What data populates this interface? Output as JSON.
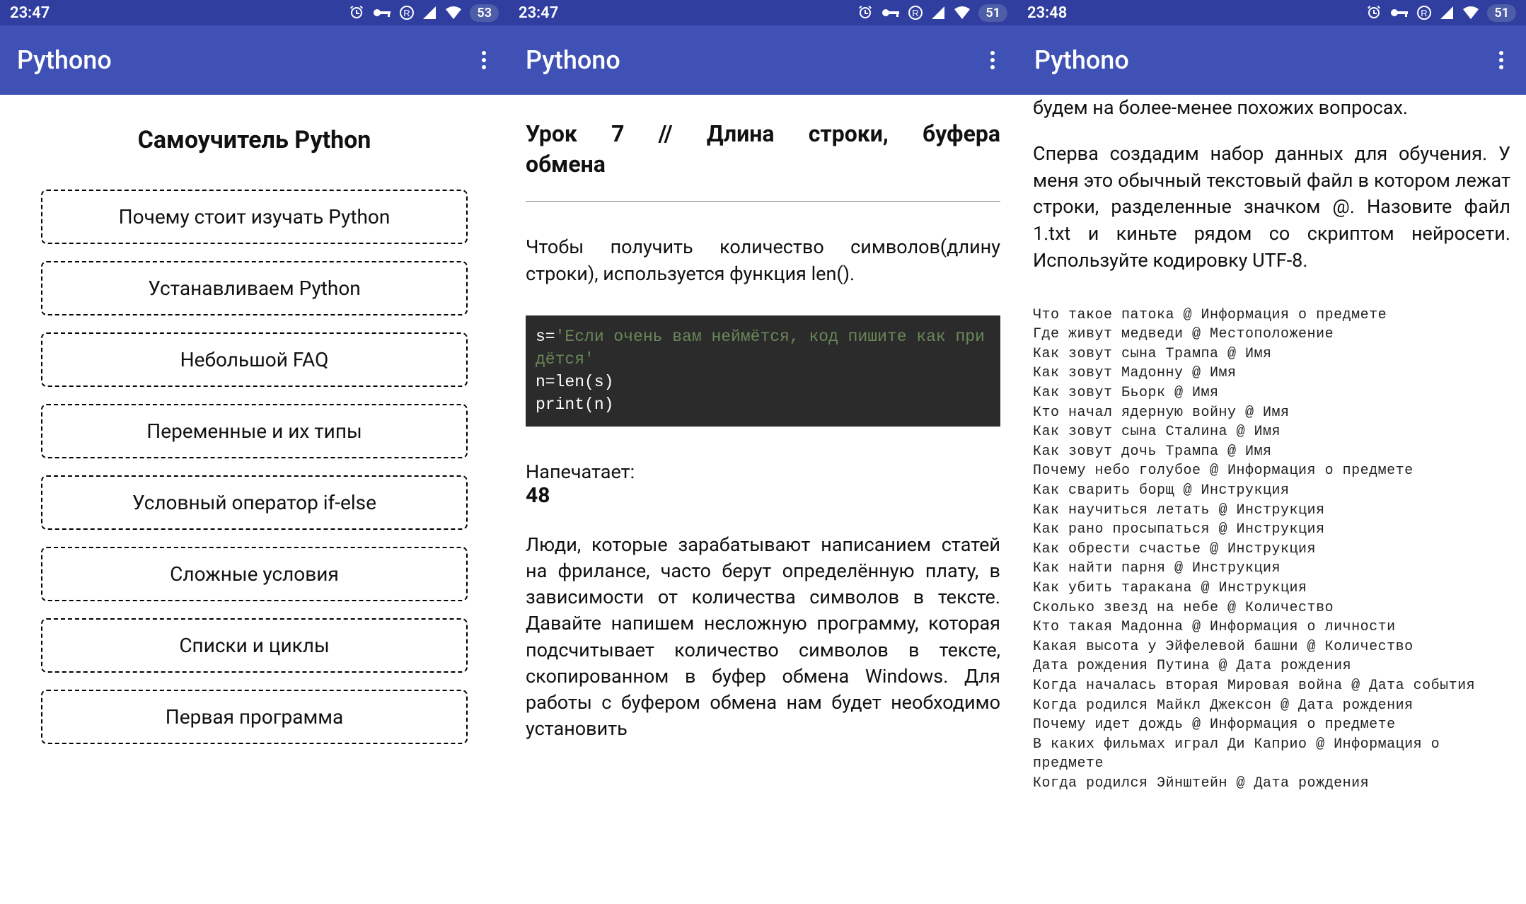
{
  "screen1": {
    "status": {
      "time": "23:47",
      "battery": "53"
    },
    "app_title": "Pythono",
    "page_title": "Самоучитель Python",
    "lessons": [
      "Почему стоит изучать Python",
      "Устанавливаем Python",
      "Небольшой FAQ",
      "Переменные и их типы",
      "Условный оператор if-else",
      "Сложные условия",
      "Списки и циклы",
      "Первая программа"
    ]
  },
  "screen2": {
    "status": {
      "time": "23:47",
      "battery": "51"
    },
    "app_title": "Pythono",
    "lesson_title_l1": "Урок 7 // Длина строки, буфера",
    "lesson_title_l2": "обмена",
    "para1": "Чтобы получить количество символов(длину строки), используется функция len().",
    "code": {
      "line1a": "s=",
      "line1b": "'Если очень вам неймётся, код пишите как придётся'",
      "line2": "n=len(s)",
      "line3": "print(n)"
    },
    "print_label": "Напечатает:",
    "print_value": "48",
    "para2": "Люди, которые зарабатывают написанием статей на фрилансе, часто берут определённую плату, в зависимости от количества символов в тексте. Давайте напишем несложную программу, которая подсчитывает количество символов в тексте, скопированном в буфер обмена Windows. Для работы с буфером обмена нам будет необходимо установить"
  },
  "screen3": {
    "status": {
      "time": "23:48",
      "battery": "51"
    },
    "app_title": "Pythono",
    "top_line": "будем на более-менее похожих вопросах.",
    "para": "Сперва создадим набор данных для обучения. У меня это обычный текстовый файл в котором лежат строки, разделенные значком @. Назовите файл 1.txt и киньте рядом со скриптом нейросети. Используйте кодировку UTF-8.",
    "dataset": "Что такое патока @ Информация о предмете\nГде живут медведи @ Местоположение\nКак зовут сына Трампа @ Имя\nКак зовут Мадонну @ Имя\nКак зовут Бьорк @ Имя\nКто начал ядерную войну @ Имя\nКак зовут сына Сталина @ Имя\nКак зовут дочь Трампа @ Имя\nПочему небо голубое @ Информация о предмете\nКак сварить борщ @ Инструкция\nКак научиться летать @ Инструкция\nКак рано просыпаться @ Инструкция\nКак обрести счастье @ Инструкция\nКак найти парня @ Инструкция\nКак убить таракана @ Инструкция\nСколько звезд на небе @ Количество\nКто такая Мадонна @ Информация о личности\nКакая высота у Эйфелевой башни @ Количество\nДата рождения Путина @ Дата рождения\nКогда началась вторая Мировая война @ Дата события\nКогда родился Майкл Джексон @ Дата рождения\nПочему идет дождь @ Информация о предмете\nВ каких фильмах играл Ди Каприо @ Информация о предмете\nКогда родился Эйнштейн @ Дата рождения"
  }
}
